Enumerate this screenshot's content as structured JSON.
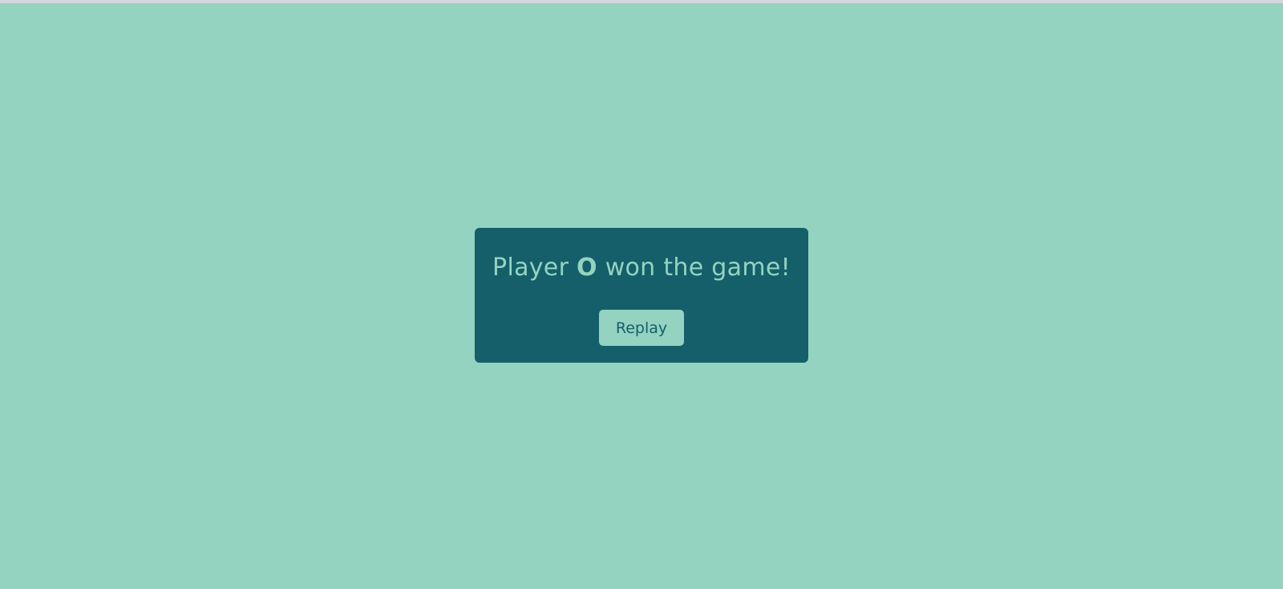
{
  "colors": {
    "background": "#94d3bf",
    "modal": "#155f6b",
    "accent_text": "#94d3bf",
    "button_text": "#155f6b"
  },
  "result": {
    "prefix": "Player ",
    "winner": "O",
    "suffix": " won the game!"
  },
  "replay_button": {
    "label": "Replay"
  }
}
